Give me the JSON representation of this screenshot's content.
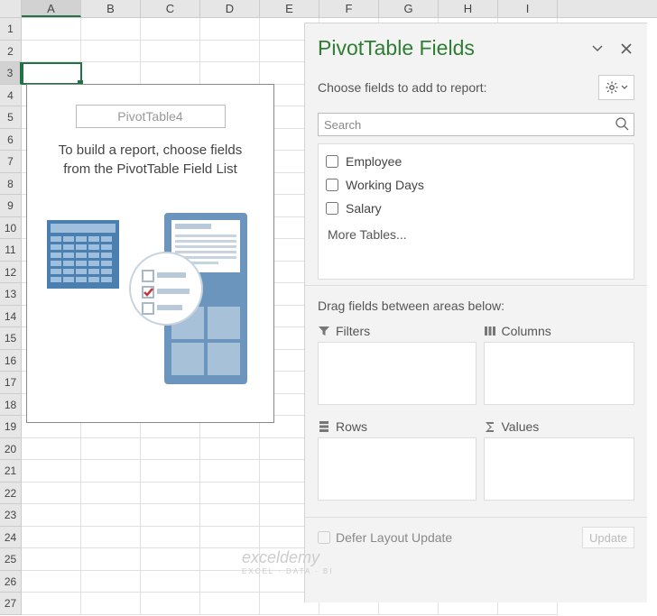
{
  "columns": [
    "A",
    "B",
    "C",
    "D",
    "E",
    "F",
    "G",
    "H",
    "I"
  ],
  "rows": [
    1,
    2,
    3,
    4,
    5,
    6,
    7,
    8,
    9,
    10,
    11,
    12,
    13,
    14,
    15,
    16,
    17,
    18,
    19,
    20,
    21,
    22,
    23,
    24,
    25,
    26,
    27
  ],
  "active_cell": "A3",
  "pivot_placeholder": {
    "title": "PivotTable4",
    "hint_line1": "To build a report, choose fields",
    "hint_line2": "from the PivotTable Field List"
  },
  "pane": {
    "title": "PivotTable Fields",
    "subtitle": "Choose fields to add to report:",
    "search_placeholder": "Search",
    "fields": [
      {
        "label": "Employee",
        "checked": false
      },
      {
        "label": "Working Days",
        "checked": false
      },
      {
        "label": "Salary",
        "checked": false
      }
    ],
    "more_tables": "More Tables...",
    "areas_header": "Drag fields between areas below:",
    "areas": {
      "filters": "Filters",
      "columns": "Columns",
      "rows": "Rows",
      "values": "Values"
    },
    "defer_label": "Defer Layout Update",
    "update_btn": "Update"
  },
  "watermark": {
    "main": "exceldemy",
    "sub": "EXCEL · DATA · BI"
  }
}
